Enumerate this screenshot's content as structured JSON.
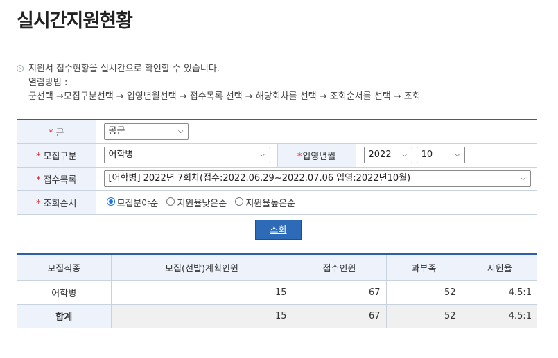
{
  "page": {
    "title": "실시간지원현황"
  },
  "info": {
    "line1": "지원서 접수현황을 실시간으로 확인할 수 있습니다.",
    "line2": "열람방법 :",
    "line3": "군선택 →모집구분선택 → 입영년월선택 → 접수목록 선택 → 해당회차를 선택 → 조회순서를 선택 → 조회"
  },
  "form": {
    "required_mark": "*",
    "army_label": "군",
    "army_value": "공군",
    "category_label": "모집구분",
    "category_value": "어학병",
    "enlist_label": "입영년월",
    "year_value": "2022",
    "month_value": "10",
    "list_label": "접수목록",
    "list_value": "[어학병] 2022년 7회차(접수:2022.06.29~2022.07.06 입영:2022년10월)",
    "order_label": "조회순서",
    "order_options": [
      "모집분야순",
      "지원율낮은순",
      "지원율높은순"
    ],
    "order_selected_index": 0
  },
  "search_button": "조회",
  "results": {
    "headers": [
      "모집직종",
      "모집(선발)계획인원",
      "접수인원",
      "과부족",
      "지원율"
    ],
    "rows": [
      {
        "name": "어학병",
        "plan": "15",
        "applied": "67",
        "diff": "52",
        "rate": "4.5:1"
      }
    ],
    "total": {
      "name": "합계",
      "plan": "15",
      "applied": "67",
      "diff": "52",
      "rate": "4.5:1"
    }
  },
  "colors": {
    "accent": "#2f5fa8",
    "button": "#2d6ab8",
    "required": "#d9272e",
    "header_bg": "#eef3fb"
  }
}
